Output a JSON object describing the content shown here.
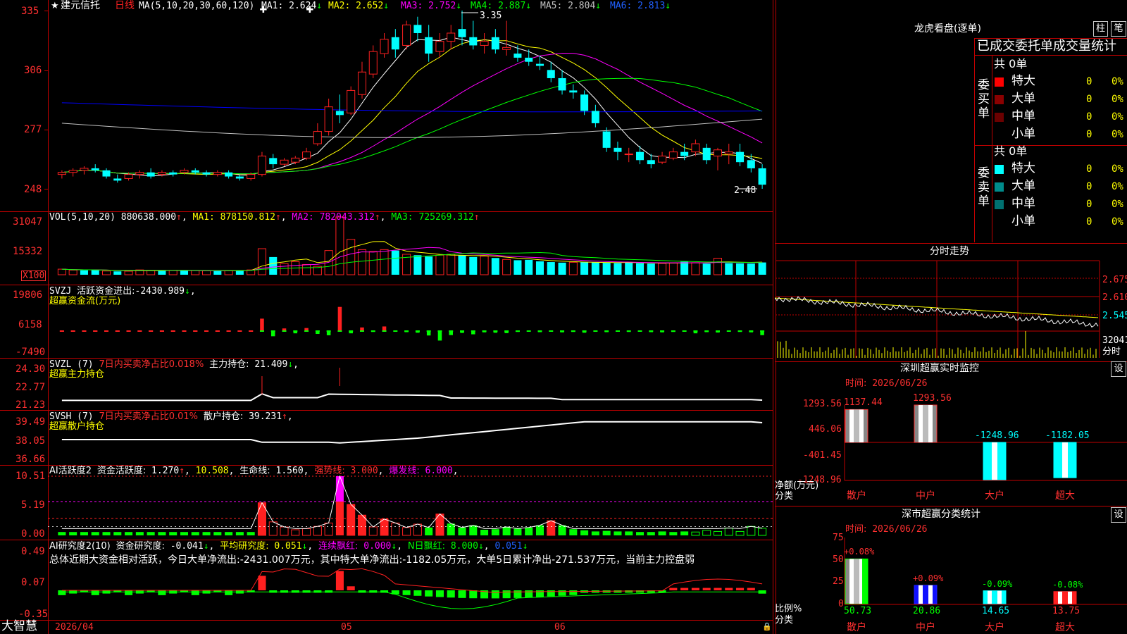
{
  "colors": {
    "up": "#ff2020",
    "down": "#00ffff",
    "frame": "#c00000",
    "ma1": "#ffffff",
    "ma2": "#ffff00",
    "ma3": "#ff00ff",
    "ma4": "#00ff00",
    "ma5": "#c0c0c0",
    "ma6": "#0000ff",
    "green": "#00ff00",
    "yellow": "#ffff00",
    "magenta": "#ff00ff",
    "cyan": "#00ffff",
    "red": "#ff3030",
    "gray": "#c0c0c0"
  },
  "header": {
    "star": "★",
    "stock_name": "建元信托",
    "period": "日线",
    "ma_params": "MA(5,10,20,30,60,120)",
    "ma": [
      {
        "label": "MA1:",
        "value": "2.624",
        "arrow": "↓"
      },
      {
        "label": "MA2:",
        "value": "2.652",
        "arrow": "↓"
      },
      {
        "label": "MA3:",
        "value": "2.752",
        "arrow": "↓"
      },
      {
        "label": "MA4:",
        "value": "2.887",
        "arrow": "↓"
      },
      {
        "label": "MA5:",
        "value": "2.804",
        "arrow": "↓"
      },
      {
        "label": "MA6:",
        "value": "2.813",
        "arrow": "↓"
      }
    ]
  },
  "price_panel": {
    "y_ticks": [
      "335",
      "306",
      "277",
      "248"
    ],
    "high_label": "3.35",
    "low_label": "2.48"
  },
  "vol_panel": {
    "title": "VOL(5,10,20)",
    "value": "880638.000",
    "ma1_label": "MA1:",
    "ma1": "878150.812",
    "ma2_label": "MA2:",
    "ma2": "782043.312",
    "ma3_label": "MA3:",
    "ma3": "725269.312",
    "arrow": "↑",
    "y_ticks": [
      "31047",
      "15332"
    ],
    "unit": "X100"
  },
  "svzj_panel": {
    "title": "SVZJ",
    "line1": "活跃资金进出:",
    "value": "-2430.989",
    "arrow": "↓",
    "sub": "超赢资金流(万元)",
    "y_ticks": [
      "19806",
      "6158",
      "-7490"
    ]
  },
  "svzl_panel": {
    "title": "SVZL (7)",
    "desc": "7日内买卖净占比0.018%",
    "label": "主力持仓:",
    "value": "21.409",
    "arrow": "↓",
    "sub": "超赢主力持仓",
    "y_ticks": [
      "24.30",
      "22.77",
      "21.23"
    ]
  },
  "svsh_panel": {
    "title": "SVSH (7)",
    "desc": "7日内买卖净占比0.01%",
    "label": "散户持仓:",
    "value": "39.231",
    "arrow": "↑",
    "sub": "超赢散户持仓",
    "y_ticks": [
      "39.49",
      "38.05",
      "36.66"
    ]
  },
  "ai_active_panel": {
    "title": "AI活跃度2",
    "label": "资金活跃度:",
    "value": "1.270",
    "arrow": "↑",
    "v2": "10.508",
    "life_label": "生命线:",
    "life": "1.560",
    "strong_label": "强势线:",
    "strong": "3.000",
    "burst_label": "爆发线:",
    "burst": "6.000",
    "y_ticks": [
      "10.51",
      "5.19",
      "0.00"
    ]
  },
  "ai_research_panel": {
    "title": "AI研究度2(10)",
    "label": "资金研究度:",
    "value": "-0.041",
    "avg_label": "平均研究度:",
    "avg": "0.051",
    "lianxu_label": "连续飘红:",
    "lianxu": "0.000",
    "n_label": "N日飘红:",
    "n": "8.000",
    "v5": "0.051",
    "summary": "总体近期大资金相对活跃，今日大单净流出:-2431.007万元，其中特大单净流出:-1182.05万元，大单5日累计净出-271.537万元，当前主力控盘弱",
    "y_ticks": [
      "0.49",
      "0.07",
      "-0.35"
    ]
  },
  "x_axis": {
    "date": "2026/04",
    "m5": "05",
    "m6": "06"
  },
  "app_name": "大智慧",
  "lhb": {
    "title": "龙虎看盘(逐单)",
    "btn_bar": "柱",
    "btn_pen": "笔",
    "tab_label": "已成交委托单成交量统计",
    "buy": {
      "side": "委买单",
      "total": "共 0单",
      "rows": [
        {
          "name": "特大",
          "count": "0",
          "pct": "0%",
          "color": "#ff0000"
        },
        {
          "name": "大单",
          "count": "0",
          "pct": "0%",
          "color": "#8b0000"
        },
        {
          "name": "中单",
          "count": "0",
          "pct": "0%",
          "color": "#6b0000"
        },
        {
          "name": "小单",
          "count": "0",
          "pct": "0%",
          "color": ""
        }
      ]
    },
    "sell": {
      "side": "委卖单",
      "total": "共 0单",
      "rows": [
        {
          "name": "特大",
          "count": "0",
          "pct": "0%",
          "color": "#00ffff"
        },
        {
          "name": "大单",
          "count": "0",
          "pct": "0%",
          "color": "#008b8b"
        },
        {
          "name": "中单",
          "count": "0",
          "pct": "0%",
          "color": "#007070"
        },
        {
          "name": "小单",
          "count": "0",
          "pct": "0%",
          "color": ""
        }
      ]
    }
  },
  "intraday": {
    "title": "分时走势",
    "prices": [
      "2.675",
      "2.610",
      "2.545"
    ],
    "vol_label": "32041",
    "vol_sub": "分时"
  },
  "sz_monitor": {
    "title": "深圳超赢实时监控",
    "btn": "设",
    "time_label": "时间:",
    "time": "2026/06/26",
    "y_ticks": [
      "1293.56",
      "446.06",
      "-401.45",
      "-1248.96"
    ],
    "y_title": "净额(万元)",
    "x_title": "分类",
    "bars": [
      {
        "cat": "散户",
        "value": 1137.44,
        "label": "1137.44"
      },
      {
        "cat": "中户",
        "value": 1293.56,
        "label": "1293.56"
      },
      {
        "cat": "大户",
        "value": -1248.96,
        "label": "-1248.96"
      },
      {
        "cat": "超大",
        "value": -1182.05,
        "label": "-1182.05"
      }
    ]
  },
  "sz_classify": {
    "title": "深市超赢分类统计",
    "btn": "设",
    "time_label": "时间:",
    "time": "2026/06/26",
    "y_ticks": [
      "75",
      "50",
      "25",
      "0"
    ],
    "y_title": "比例%",
    "x_title": "分类",
    "bars": [
      {
        "cat": "散户",
        "value": 50.73,
        "label": "50.73",
        "delta": "+0.08%"
      },
      {
        "cat": "中户",
        "value": 20.86,
        "label": "20.86",
        "delta": "+0.09%"
      },
      {
        "cat": "大户",
        "value": 14.65,
        "label": "14.65",
        "delta": "-0.09%"
      },
      {
        "cat": "超大",
        "value": 13.75,
        "label": "13.75",
        "delta": "-0.08%"
      }
    ]
  },
  "chart_data": [
    {
      "type": "candlestick",
      "title": "建元信托 日线",
      "ylim": [
        2.4,
        3.4
      ],
      "ma_values": {
        "MA1": 2.624,
        "MA2": 2.652,
        "MA3": 2.752,
        "MA4": 2.887,
        "MA5": 2.804,
        "MA6": 2.813
      },
      "ohlc": [
        [
          2.55,
          2.57,
          2.53,
          2.56
        ],
        [
          2.56,
          2.58,
          2.54,
          2.57
        ],
        [
          2.57,
          2.59,
          2.55,
          2.58
        ],
        [
          2.58,
          2.6,
          2.56,
          2.57
        ],
        [
          2.57,
          2.58,
          2.53,
          2.54
        ],
        [
          2.53,
          2.55,
          2.51,
          2.52
        ],
        [
          2.53,
          2.56,
          2.52,
          2.55
        ],
        [
          2.55,
          2.57,
          2.53,
          2.56
        ],
        [
          2.56,
          2.58,
          2.53,
          2.54
        ],
        [
          2.55,
          2.57,
          2.54,
          2.56
        ],
        [
          2.56,
          2.57,
          2.54,
          2.55
        ],
        [
          2.56,
          2.58,
          2.55,
          2.57
        ],
        [
          2.57,
          2.58,
          2.55,
          2.56
        ],
        [
          2.56,
          2.57,
          2.54,
          2.55
        ],
        [
          2.55,
          2.57,
          2.54,
          2.56
        ],
        [
          2.56,
          2.57,
          2.53,
          2.54
        ],
        [
          2.54,
          2.55,
          2.52,
          2.53
        ],
        [
          2.53,
          2.56,
          2.52,
          2.55
        ],
        [
          2.55,
          2.66,
          2.54,
          2.64
        ],
        [
          2.63,
          2.65,
          2.58,
          2.6
        ],
        [
          2.6,
          2.63,
          2.59,
          2.62
        ],
        [
          2.61,
          2.64,
          2.6,
          2.63
        ],
        [
          2.63,
          2.68,
          2.62,
          2.66
        ],
        [
          2.7,
          2.8,
          2.69,
          2.76
        ],
        [
          2.76,
          2.92,
          2.74,
          2.88
        ],
        [
          2.86,
          2.94,
          2.8,
          2.84
        ],
        [
          2.85,
          2.98,
          2.84,
          2.96
        ],
        [
          2.94,
          3.1,
          2.92,
          3.05
        ],
        [
          3.04,
          3.18,
          3.02,
          3.15
        ],
        [
          3.14,
          3.24,
          3.12,
          3.21
        ],
        [
          3.22,
          3.26,
          3.12,
          3.16
        ],
        [
          3.18,
          3.3,
          3.16,
          3.28
        ],
        [
          3.28,
          3.32,
          3.2,
          3.24
        ],
        [
          3.22,
          3.28,
          3.1,
          3.14
        ],
        [
          3.15,
          3.24,
          3.12,
          3.2
        ],
        [
          3.2,
          3.28,
          3.16,
          3.24
        ],
        [
          3.26,
          3.35,
          3.18,
          3.22
        ],
        [
          3.22,
          3.3,
          3.16,
          3.18
        ],
        [
          3.18,
          3.24,
          3.14,
          3.2
        ],
        [
          3.22,
          3.26,
          3.14,
          3.16
        ],
        [
          3.16,
          3.3,
          3.13,
          3.17
        ],
        [
          3.14,
          3.18,
          3.1,
          3.12
        ],
        [
          3.12,
          3.16,
          3.08,
          3.1
        ],
        [
          3.09,
          3.13,
          3.06,
          3.08
        ],
        [
          3.06,
          3.1,
          3.0,
          3.02
        ],
        [
          3.02,
          3.06,
          2.94,
          2.96
        ],
        [
          2.96,
          2.99,
          2.92,
          2.95
        ],
        [
          2.94,
          2.96,
          2.84,
          2.86
        ],
        [
          2.86,
          2.89,
          2.78,
          2.8
        ],
        [
          2.76,
          2.78,
          2.66,
          2.68
        ],
        [
          2.68,
          2.71,
          2.62,
          2.66
        ],
        [
          2.65,
          2.68,
          2.61,
          2.65
        ],
        [
          2.66,
          2.69,
          2.6,
          2.62
        ],
        [
          2.62,
          2.65,
          2.58,
          2.6
        ],
        [
          2.61,
          2.66,
          2.6,
          2.64
        ],
        [
          2.63,
          2.68,
          2.62,
          2.66
        ],
        [
          2.66,
          2.7,
          2.62,
          2.64
        ],
        [
          2.66,
          2.72,
          2.64,
          2.7
        ],
        [
          2.68,
          2.7,
          2.6,
          2.62
        ],
        [
          2.64,
          2.68,
          2.57,
          2.67
        ],
        [
          2.65,
          2.7,
          2.6,
          2.66
        ],
        [
          2.66,
          2.7,
          2.59,
          2.61
        ],
        [
          2.62,
          2.65,
          2.56,
          2.58
        ],
        [
          2.58,
          2.6,
          2.48,
          2.5
        ]
      ]
    },
    {
      "type": "bar",
      "title": "VOL(5,10,20)",
      "values": [
        3000,
        2500,
        2400,
        2600,
        2000,
        1800,
        1900,
        2600,
        2400,
        2200,
        2400,
        2300,
        2300,
        2100,
        2000,
        2200,
        2400,
        2600,
        14000,
        9500,
        6000,
        7000,
        5500,
        4500,
        13000,
        31047,
        19000,
        13500,
        12500,
        13500,
        13000,
        11000,
        10500,
        9800,
        10500,
        11000,
        10500,
        9500,
        10000,
        9000,
        8200,
        7800,
        8000,
        7200,
        6800,
        6500,
        6700,
        6800,
        6600,
        6400,
        6300,
        6800,
        6200,
        6000,
        6100,
        6300,
        7000,
        6500,
        6000,
        8900,
        6200,
        6100,
        6000,
        6600
      ],
      "down": [
        false,
        false,
        true,
        true,
        false,
        true,
        false,
        false,
        false,
        true,
        false,
        true,
        false,
        false,
        true,
        false,
        true,
        false,
        false,
        true,
        false,
        false,
        false,
        false,
        false,
        false,
        false,
        false,
        false,
        false,
        true,
        false,
        true,
        true,
        false,
        false,
        true,
        true,
        false,
        true,
        false,
        true,
        true,
        true,
        true,
        true,
        false,
        true,
        true,
        true,
        true,
        true,
        true,
        true,
        false,
        false,
        true,
        false,
        true,
        false,
        true,
        true,
        true,
        true
      ]
    },
    {
      "type": "bar",
      "title": "SVZJ",
      "values": [
        0,
        0,
        0,
        0,
        0,
        0,
        0,
        0,
        0,
        0,
        0,
        0,
        0,
        0,
        0,
        0,
        0,
        0,
        6000,
        -3000,
        1000,
        -1500,
        1200,
        -1800,
        -2500,
        12000,
        -1500,
        1500,
        -800,
        2000,
        -500,
        -900,
        -1200,
        -2600,
        -5200,
        -2400,
        -1300,
        -2000,
        -1000,
        -1200,
        -1400,
        -800,
        -600,
        -900,
        -700,
        -1000,
        -800,
        -1200,
        -700,
        -900,
        -600,
        -800,
        -700,
        -900,
        -1000,
        -800,
        -600,
        -1500,
        -900,
        -1100,
        -700,
        -800,
        -1000,
        -2431
      ]
    },
    {
      "type": "line",
      "title": "SVZL 主力持仓",
      "ylim": [
        21.23,
        24.3
      ],
      "last": 21.409
    },
    {
      "type": "line",
      "title": "SVSH 散户持仓",
      "ylim": [
        36.66,
        39.49
      ],
      "last": 39.231
    },
    {
      "type": "bar",
      "title": "AI活跃度2",
      "ylim": [
        0,
        10.51
      ],
      "last": 1.27,
      "strong": 3.0,
      "burst": 6.0,
      "life": 1.56
    },
    {
      "type": "bar",
      "title": "AI研究度2(10)",
      "ylim": [
        -0.35,
        0.49
      ],
      "last": -0.041
    },
    {
      "type": "bar",
      "title": "深圳超赢实时监控",
      "categories": [
        "散户",
        "中户",
        "大户",
        "超大"
      ],
      "values": [
        1137.44,
        1293.56,
        -1248.96,
        -1182.05
      ]
    },
    {
      "type": "bar",
      "title": "深市超赢分类统计",
      "categories": [
        "散户",
        "中户",
        "大户",
        "超大"
      ],
      "values": [
        50.73,
        20.86,
        14.65,
        13.75
      ]
    }
  ]
}
